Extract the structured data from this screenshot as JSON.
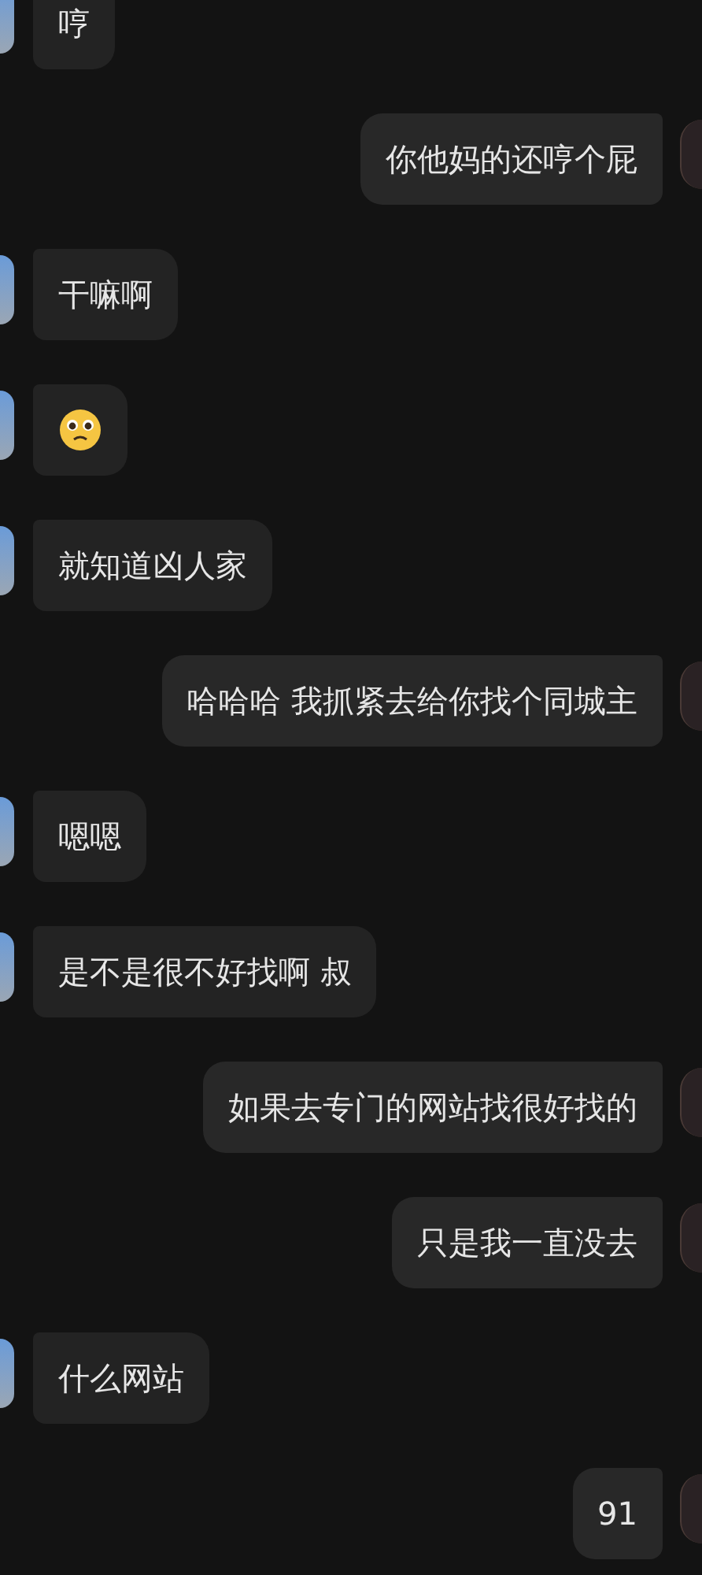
{
  "messages": [
    {
      "outgoing": false,
      "kind": "text",
      "text": "哼"
    },
    {
      "outgoing": true,
      "kind": "text",
      "text": "你他妈的还哼个屁"
    },
    {
      "outgoing": false,
      "kind": "text",
      "text": "干嘛啊"
    },
    {
      "outgoing": false,
      "kind": "emoji"
    },
    {
      "outgoing": false,
      "kind": "text",
      "text": "就知道凶人家"
    },
    {
      "outgoing": true,
      "kind": "text",
      "text": "哈哈哈 我抓紧去给你找个同城主"
    },
    {
      "outgoing": false,
      "kind": "text",
      "text": "嗯嗯"
    },
    {
      "outgoing": false,
      "kind": "text",
      "text": "是不是很不好找啊 叔"
    },
    {
      "outgoing": true,
      "kind": "text",
      "text": "如果去专门的网站找很好找的"
    },
    {
      "outgoing": true,
      "kind": "text",
      "text": "只是我一直没去"
    },
    {
      "outgoing": false,
      "kind": "text",
      "text": "什么网站"
    },
    {
      "outgoing": true,
      "kind": "text",
      "text": "91"
    }
  ]
}
